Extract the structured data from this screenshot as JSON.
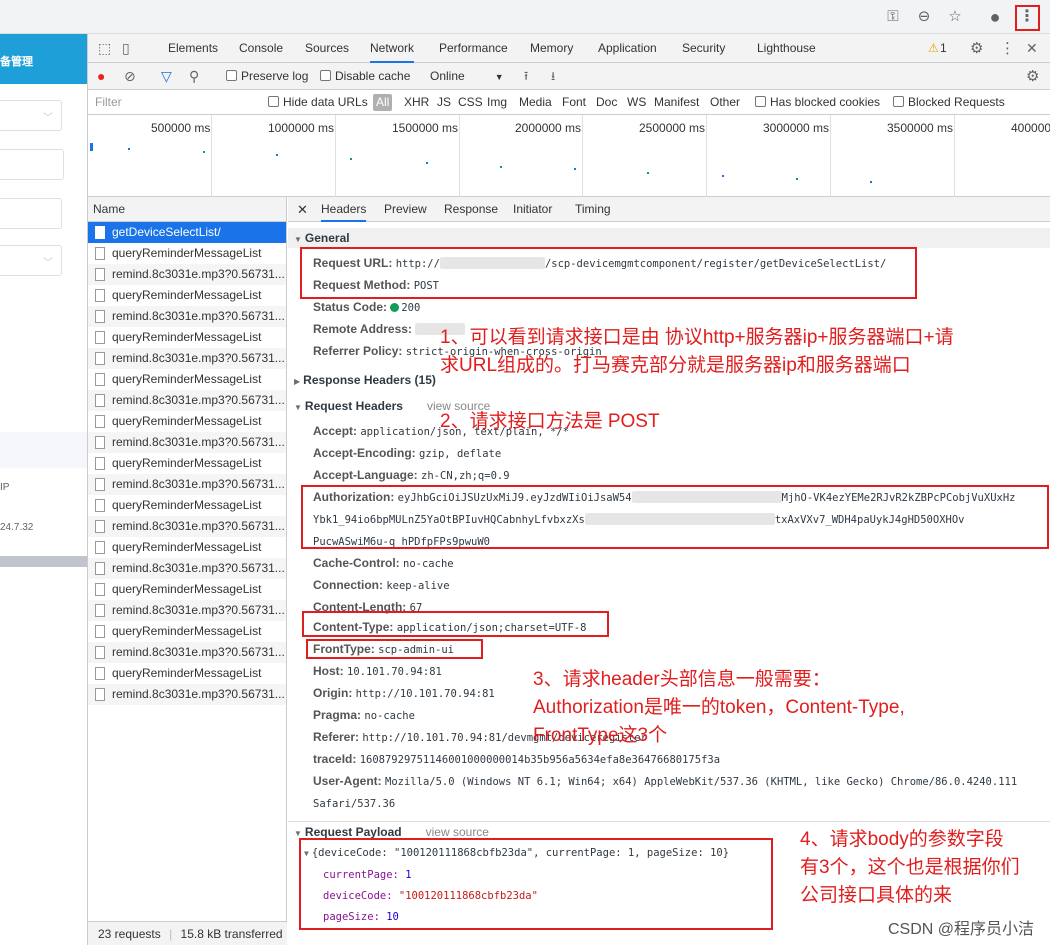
{
  "browser": {
    "icons": [
      "key-icon",
      "zoom-out-icon",
      "star-icon",
      "profile-icon",
      "kebab-menu-icon"
    ]
  },
  "app": {
    "header_text": "备管理",
    "col_label": "IP",
    "cell_value": "24.7.32"
  },
  "devtools": {
    "tabs": [
      "Elements",
      "Console",
      "Sources",
      "Network",
      "Performance",
      "Memory",
      "Application",
      "Security",
      "Lighthouse"
    ],
    "active_tab": "Network",
    "warning_count": "1",
    "toolbar": {
      "preserve_log": "Preserve log",
      "disable_cache": "Disable cache",
      "throttle": "Online"
    },
    "filter": {
      "placeholder": "Filter",
      "hide_data_urls": "Hide data URLs",
      "types": [
        "All",
        "XHR",
        "JS",
        "CSS",
        "Img",
        "Media",
        "Font",
        "Doc",
        "WS",
        "Manifest",
        "Other"
      ],
      "has_blocked_cookies": "Has blocked cookies",
      "blocked_requests": "Blocked Requests"
    },
    "timeline_ticks": [
      "500000 ms",
      "1000000 ms",
      "1500000 ms",
      "2000000 ms",
      "2500000 ms",
      "3000000 ms",
      "3500000 ms",
      "400000"
    ]
  },
  "requests": {
    "header": "Name",
    "items": [
      "getDeviceSelectList/",
      "queryReminderMessageList",
      "remind.8c3031e.mp3?0.56731...",
      "queryReminderMessageList",
      "remind.8c3031e.mp3?0.56731...",
      "queryReminderMessageList",
      "remind.8c3031e.mp3?0.56731...",
      "queryReminderMessageList",
      "remind.8c3031e.mp3?0.56731...",
      "queryReminderMessageList",
      "remind.8c3031e.mp3?0.56731...",
      "queryReminderMessageList",
      "remind.8c3031e.mp3?0.56731...",
      "queryReminderMessageList",
      "remind.8c3031e.mp3?0.56731...",
      "queryReminderMessageList",
      "remind.8c3031e.mp3?0.56731...",
      "queryReminderMessageList",
      "remind.8c3031e.mp3?0.56731...",
      "queryReminderMessageList",
      "remind.8c3031e.mp3?0.56731...",
      "queryReminderMessageList",
      "remind.8c3031e.mp3?0.56731..."
    ],
    "status_count": "23 requests",
    "status_transferred": "15.8 kB transferred"
  },
  "details": {
    "tabs": [
      "Headers",
      "Preview",
      "Response",
      "Initiator",
      "Timing"
    ],
    "active_tab": "Headers",
    "general": {
      "title": "General",
      "request_url_key": "Request URL:",
      "request_url_prefix": "http://",
      "request_url_suffix": "/scp-devicemgmtcomponent/register/getDeviceSelectList/",
      "request_method_key": "Request Method:",
      "request_method": "POST",
      "status_code_key": "Status Code:",
      "status_code": "200",
      "remote_address_key": "Remote Address:",
      "referrer_policy_key": "Referrer Policy:",
      "referrer_policy": "strict-origin-when-cross-origin"
    },
    "response_headers": "Response Headers (15)",
    "request_headers": {
      "title": "Request Headers",
      "view_source": "view source",
      "accept_k": "Accept:",
      "accept_v": "application/json, text/plain, */*",
      "accept_encoding_k": "Accept-Encoding:",
      "accept_encoding_v": "gzip, deflate",
      "accept_language_k": "Accept-Language:",
      "accept_language_v": "zh-CN,zh;q=0.9",
      "authorization_k": "Authorization:",
      "authorization_v1": "eyJhbGciOiJSUzUxMiJ9.eyJzdWIiOiJsaW54",
      "authorization_v1b": "MjhO-VK4ezYEMe2RJvR2kZBPcPCobjVuXUxHz",
      "authorization_v2": "Ybk1_94io6bpMULnZ5YaOtBPIuvHQCabnhyLfvbxzXs",
      "authorization_v2b": "txAxVXv7_WDH4paUykJ4gHD50OXHOv",
      "authorization_v3": "PucwASwiM6u-q_hPDfpFPs9pwuW0",
      "cache_control_k": "Cache-Control:",
      "cache_control_v": "no-cache",
      "connection_k": "Connection:",
      "connection_v": "keep-alive",
      "content_length_k": "Content-Length:",
      "content_length_v": "67",
      "content_type_k": "Content-Type:",
      "content_type_v": "application/json;charset=UTF-8",
      "front_type_k": "FrontType:",
      "front_type_v": "scp-admin-ui",
      "host_k": "Host:",
      "host_v": "10.101.70.94:81",
      "origin_k": "Origin:",
      "origin_v": "http://10.101.70.94:81",
      "pragma_k": "Pragma:",
      "pragma_v": "no-cache",
      "referer_k": "Referer:",
      "referer_v": "http://10.101.70.94:81/devmgmt/deviceregister",
      "traceid_k": "traceId:",
      "traceid_v": "16087929751146001000000014b35b956a5634efa8e36476680175f3a",
      "user_agent_k": "User-Agent:",
      "user_agent_v": "Mozilla/5.0 (Windows NT 6.1; Win64; x64) AppleWebKit/537.36 (KHTML, like Gecko) Chrome/86.0.4240.111",
      "user_agent_v2": "Safari/537.36"
    },
    "payload": {
      "title": "Request Payload",
      "view_source": "view source",
      "summary": "{deviceCode: \"100120111868cbfb23da\", currentPage: 1, pageSize: 10}",
      "current_page_k": "currentPage:",
      "current_page_v": "1",
      "device_code_k": "deviceCode:",
      "device_code_v": "\"100120111868cbfb23da\"",
      "page_size_k": "pageSize:",
      "page_size_v": "10"
    }
  },
  "annotations": {
    "a1_line1": "1、可以看到请求接口是由 协议http+服务器ip+服务器端口+请",
    "a1_line2": "求URL组成的。打马赛克部分就是服务器ip和服务器端口",
    "a2": "2、请求接口方法是 POST",
    "a3_line1": "3、请求header头部信息一般需要：",
    "a3_line2": "Authorization是唯一的token，Content-Type,",
    "a3_line3": "FrontType这3个",
    "a4_line1": "4、请求body的参数字段",
    "a4_line2": "有3个，这个也是根据你们",
    "a4_line3": "公司接口具体的来"
  },
  "watermark": "CSDN @程序员小洁",
  "colors": {
    "annotation": "#e01e1e",
    "accent": "#1a73e8",
    "app_header": "#1f9fd8"
  }
}
